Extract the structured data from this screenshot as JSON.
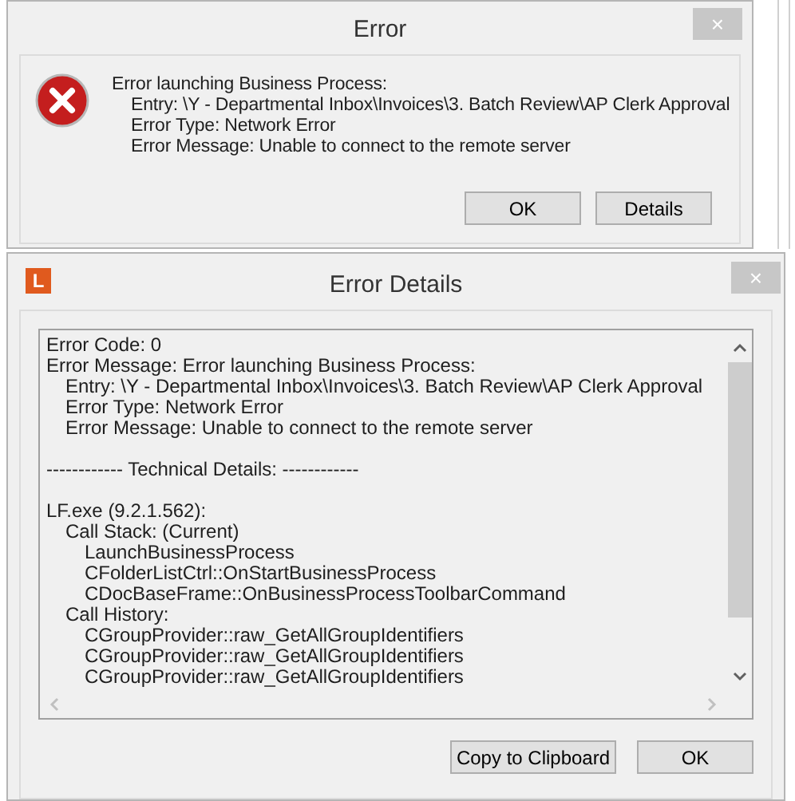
{
  "error_dialog": {
    "title": "Error",
    "close": "×",
    "heading": "Error launching Business Process:",
    "details": [
      "Entry: \\Y - Departmental Inbox\\Invoices\\3. Batch Review\\AP Clerk Approval",
      "Error Type: Network Error",
      "Error Message: Unable to connect to the remote server"
    ],
    "buttons": [
      "OK",
      "Details"
    ]
  },
  "details_dialog": {
    "app_icon": "L",
    "title": "Error Details",
    "close": "×",
    "blocks": [
      [
        {
          "text": "Error Code: 0"
        },
        {
          "text": "Error Message: Error launching Business Process:",
          "children": [
            {
              "text": "Entry: \\Y - Departmental Inbox\\Invoices\\3. Batch Review\\AP Clerk Approval"
            },
            {
              "text": "Error Type: Network Error"
            },
            {
              "text": "Error Message: Unable to connect to the remote server"
            }
          ]
        }
      ],
      [
        {
          "text": "------------ Technical Details: ------------"
        }
      ],
      [
        {
          "text": "LF.exe (9.2.1.562):",
          "children": [
            {
              "text": "Call Stack: (Current)",
              "children": [
                {
                  "text": "LaunchBusinessProcess"
                },
                {
                  "text": "CFolderListCtrl::OnStartBusinessProcess"
                },
                {
                  "text": "CDocBaseFrame::OnBusinessProcessToolbarCommand"
                }
              ]
            },
            {
              "text": "Call History:",
              "children": [
                {
                  "text": "CGroupProvider::raw_GetAllGroupIdentifiers"
                },
                {
                  "text": "CGroupProvider::raw_GetAllGroupIdentifiers"
                },
                {
                  "text": "CGroupProvider::raw_GetAllGroupIdentifiers"
                }
              ]
            }
          ]
        }
      ]
    ],
    "buttons": [
      "Copy to Clipboard",
      "OK"
    ]
  }
}
